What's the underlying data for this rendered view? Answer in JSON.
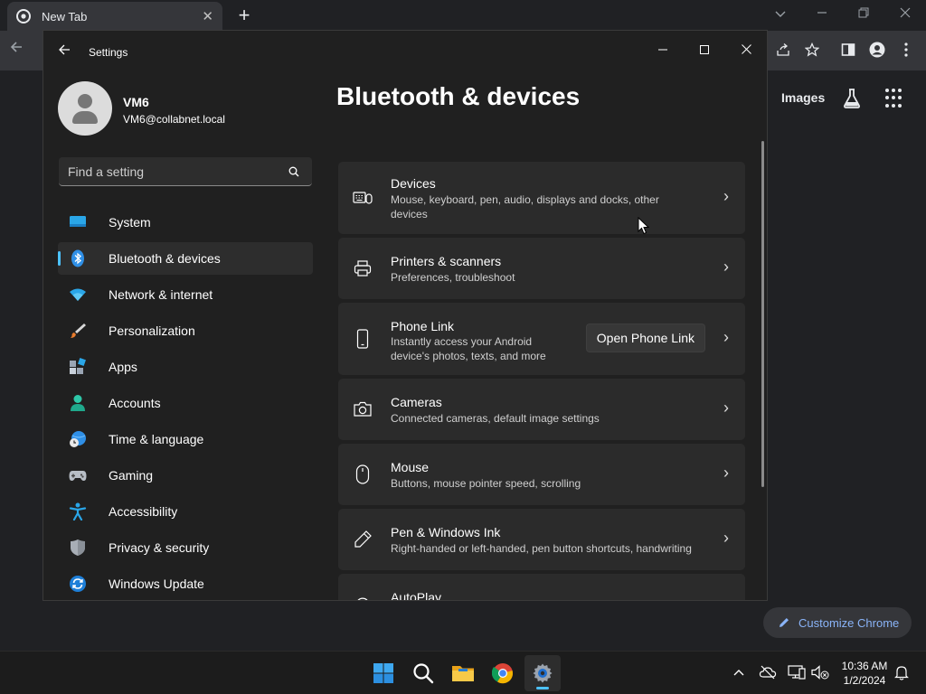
{
  "chrome": {
    "tab_title": "New Tab",
    "tab_close": "✕",
    "new_tab": "+",
    "images_link": "Images",
    "customize_label": "Customize Chrome"
  },
  "settings": {
    "window_title": "Settings",
    "profile": {
      "name": "VM6",
      "email": "VM6@collabnet.local"
    },
    "search_placeholder": "Find a setting",
    "page_title": "Bluetooth & devices",
    "nav": [
      {
        "label": "System",
        "icon": "system-icon"
      },
      {
        "label": "Bluetooth & devices",
        "icon": "bluetooth-icon",
        "active": true
      },
      {
        "label": "Network & internet",
        "icon": "wifi-icon"
      },
      {
        "label": "Personalization",
        "icon": "brush-icon"
      },
      {
        "label": "Apps",
        "icon": "apps-icon"
      },
      {
        "label": "Accounts",
        "icon": "person-icon"
      },
      {
        "label": "Time & language",
        "icon": "globe-clock-icon"
      },
      {
        "label": "Gaming",
        "icon": "controller-icon"
      },
      {
        "label": "Accessibility",
        "icon": "accessibility-icon"
      },
      {
        "label": "Privacy & security",
        "icon": "shield-icon"
      },
      {
        "label": "Windows Update",
        "icon": "update-icon"
      }
    ],
    "cards": [
      {
        "title": "Devices",
        "subtitle_1": "Mouse, keyboard, pen, audio, displays and docks, other",
        "subtitle_2": "devices",
        "icon": "devices-icon"
      },
      {
        "title": "Printers & scanners",
        "subtitle_1": "Preferences, troubleshoot",
        "icon": "printer-icon"
      },
      {
        "title": "Phone Link",
        "subtitle_1": "Instantly access your Android",
        "subtitle_2": "device's photos, texts, and more",
        "button": "Open Phone Link",
        "icon": "phone-icon"
      },
      {
        "title": "Cameras",
        "subtitle_1": "Connected cameras, default image settings",
        "icon": "camera-icon"
      },
      {
        "title": "Mouse",
        "subtitle_1": "Buttons, mouse pointer speed, scrolling",
        "icon": "mouse-icon"
      },
      {
        "title": "Pen & Windows Ink",
        "subtitle_1": "Right-handed or left-handed, pen button shortcuts, handwriting",
        "icon": "pen-icon"
      },
      {
        "title": "AutoPlay",
        "icon": "autoplay-icon"
      }
    ],
    "chevron": "›"
  },
  "taskbar": {
    "time": "10:36 AM",
    "date": "1/2/2024"
  },
  "colors": {
    "accent": "#4cc2ff",
    "window_bg": "#202020",
    "card_bg": "#2b2b2b",
    "chrome_link": "#8ab4f8"
  }
}
